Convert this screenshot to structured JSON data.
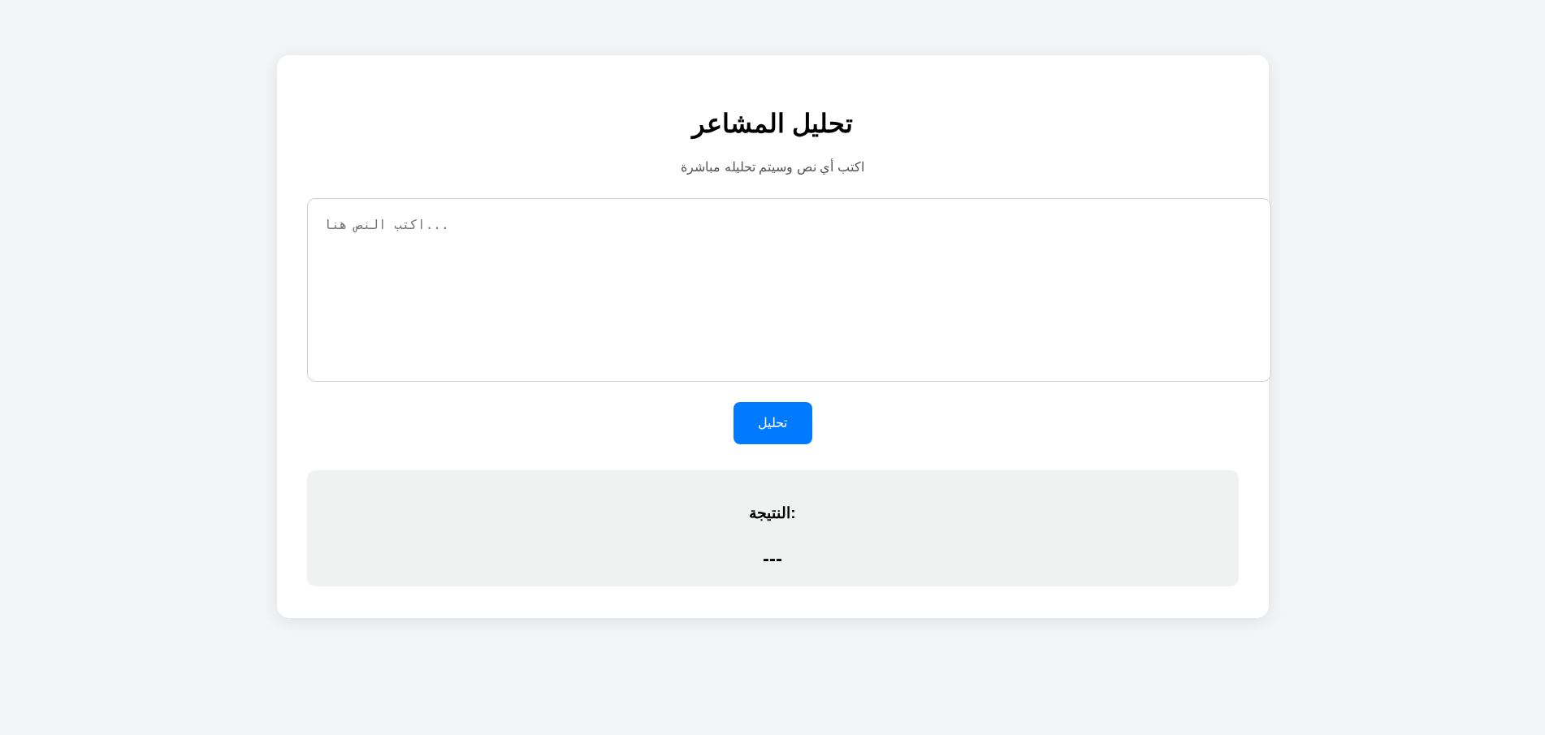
{
  "title": "تحليل المشاعر",
  "subtitle": "اكتب أي نص وسيتم تحليله مباشرة",
  "text_input": {
    "placeholder": "اكتب النص هنا..."
  },
  "analyze_button": {
    "label": "تحليل"
  },
  "result": {
    "heading": "النتيجة:",
    "value": "---"
  }
}
